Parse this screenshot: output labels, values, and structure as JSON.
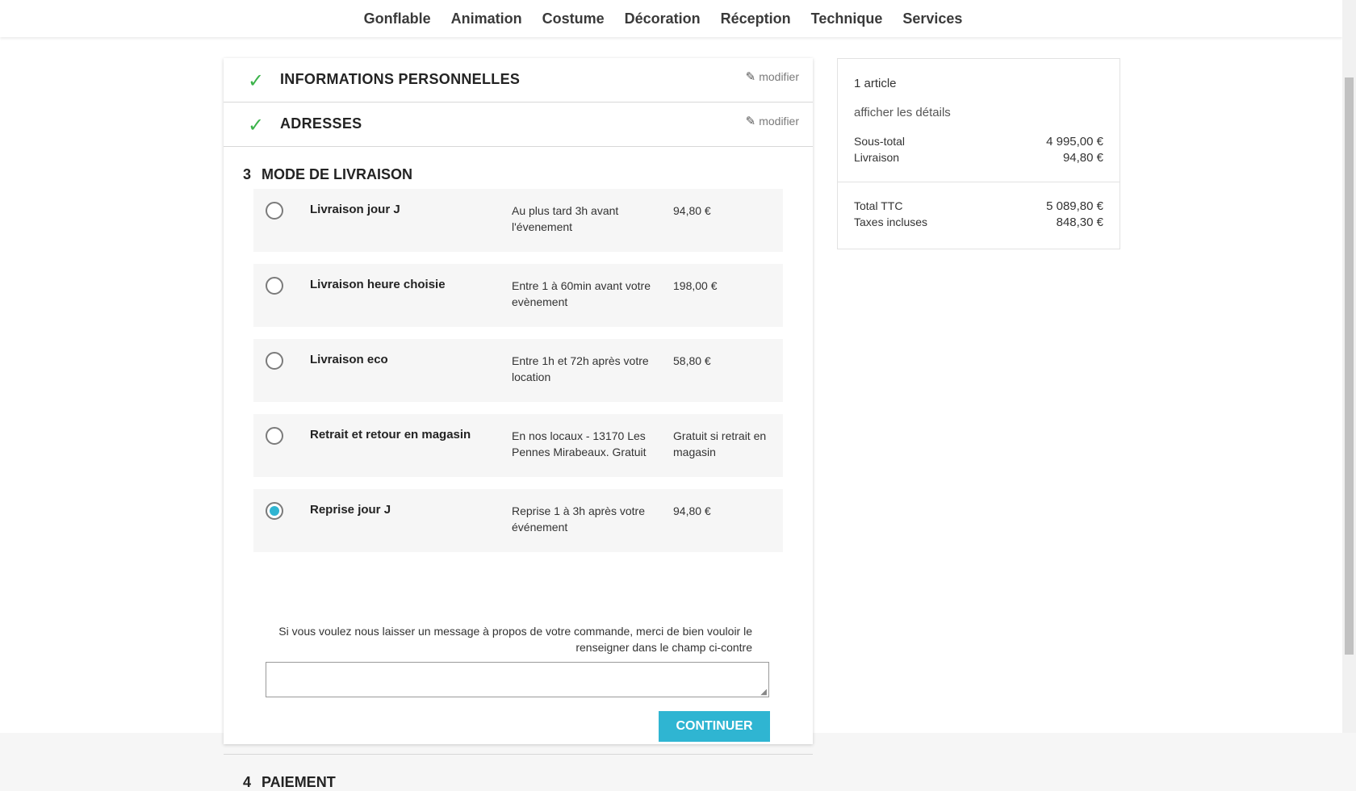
{
  "nav": {
    "items": [
      "Gonflable",
      "Animation",
      "Costume",
      "Décoration",
      "Réception",
      "Technique",
      "Services"
    ]
  },
  "steps": {
    "personal": {
      "title": "INFORMATIONS PERSONNELLES",
      "edit": "modifier"
    },
    "addresses": {
      "title": "ADRESSES",
      "edit": "modifier"
    },
    "delivery": {
      "number": "3",
      "title": "MODE DE LIVRAISON",
      "options": [
        {
          "name": "Livraison jour J",
          "desc": "Au plus tard 3h avant l'évenement",
          "price": "94,80 €",
          "selected": false
        },
        {
          "name": "Livraison heure choisie",
          "desc": "Entre 1 à 60min avant votre evènement",
          "price": "198,00 €",
          "selected": false
        },
        {
          "name": "Livraison eco",
          "desc": "Entre 1h et 72h après votre location",
          "price": "58,80 €",
          "selected": false
        },
        {
          "name": "Retrait et retour en magasin",
          "desc": "En nos locaux - 13170 Les Pennes Mirabeaux. Gratuit",
          "price": "Gratuit si retrait en magasin",
          "selected": false
        },
        {
          "name": "Reprise jour J",
          "desc": "Reprise 1 à 3h après votre événement",
          "price": "94,80 €",
          "selected": true
        }
      ],
      "message_label": "Si vous voulez nous laisser un message à propos de votre commande, merci de bien vouloir le renseigner dans le champ ci-contre",
      "message_value": "",
      "continue": "CONTINUER"
    },
    "payment": {
      "number": "4",
      "title": "PAIEMENT"
    }
  },
  "summary": {
    "items": "1 article",
    "details": "afficher les détails",
    "subtotal_label": "Sous-total",
    "subtotal_value": "4 995,00 €",
    "shipping_label": "Livraison",
    "shipping_value": "94,80 €",
    "total_label": "Total TTC",
    "total_value": "5 089,80 €",
    "taxes_label": "Taxes incluses",
    "taxes_value": "848,30 €"
  },
  "colors": {
    "accent": "#2fb5d2",
    "check": "#3bb34a"
  },
  "icons": {
    "check": "check-icon",
    "edit": "pencil-icon"
  }
}
